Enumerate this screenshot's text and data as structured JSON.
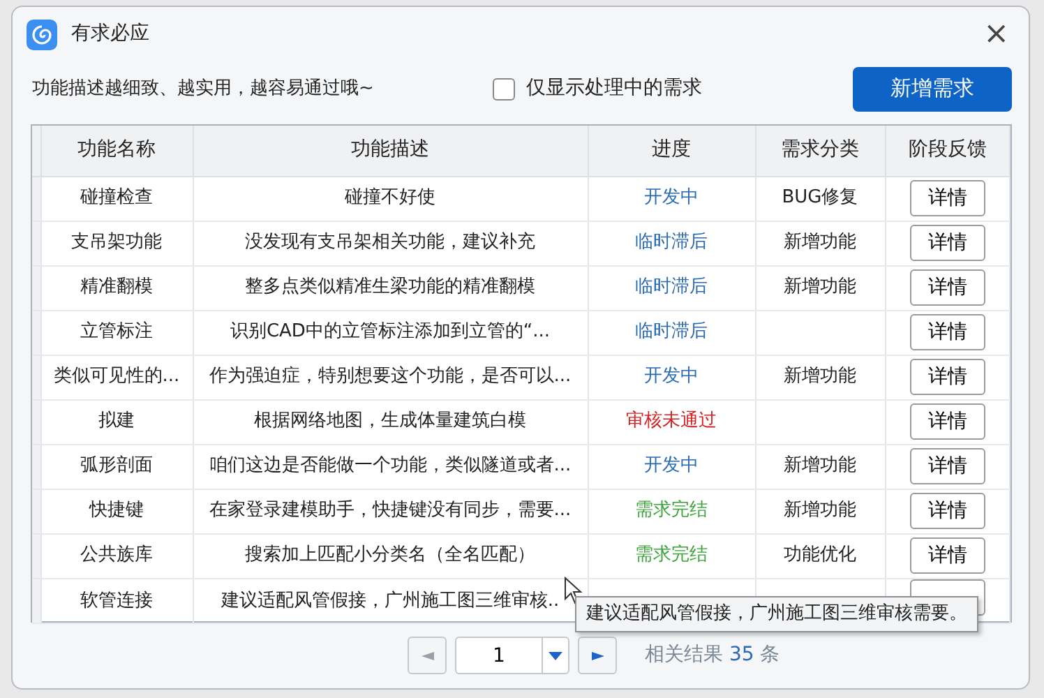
{
  "window": {
    "title": "有求必应",
    "close": "×"
  },
  "toolbar": {
    "hint": "功能描述越细致、越实用，越容易通过哦~",
    "filter": {
      "label": "仅显示处理中的需求",
      "checked": false
    },
    "add_button": "新增需求"
  },
  "table": {
    "columns": [
      "功能名称",
      "功能描述",
      "进度",
      "需求分类",
      "阶段反馈"
    ],
    "rows": [
      {
        "name": "碰撞检查",
        "description": "碰撞不好使",
        "progress": "开发中",
        "color": "#2a6ab5",
        "category": "BUG修复",
        "action": "详情"
      },
      {
        "name": "支吊架功能",
        "description": "没发现有支吊架相关功能，建议补充",
        "progress": "临时滞后",
        "color": "#2a6ab5",
        "category": "新增功能",
        "action": "详情"
      },
      {
        "name": "精准翻模",
        "description": "整多点类似精准生梁功能的精准翻模",
        "progress": "临时滞后",
        "color": "#2a6ab5",
        "category": "新增功能",
        "action": "详情"
      },
      {
        "name": "立管标注",
        "description": "识别CAD中的立管标注添加到立管的“...",
        "progress": "临时滞后",
        "color": "#2a6ab5",
        "category": "",
        "action": "详情"
      },
      {
        "name": "类似可见性的...",
        "description": "作为强迫症，特别想要这个功能，是否可以...",
        "progress": "开发中",
        "color": "#2a6ab5",
        "category": "新增功能",
        "action": "详情"
      },
      {
        "name": "拟建",
        "description": "根据网络地图，生成体量建筑白模",
        "progress": "审核未通过",
        "color": "#d42020",
        "category": "",
        "action": "详情"
      },
      {
        "name": "弧形剖面",
        "description": "咱们这边是否能做一个功能，类似隧道或者...",
        "progress": "开发中",
        "color": "#2a6ab5",
        "category": "新增功能",
        "action": "详情"
      },
      {
        "name": "快捷键",
        "description": "在家登录建模助手，快捷键没有同步，需要...",
        "progress": "需求完结",
        "color": "#3aa53a",
        "category": "新增功能",
        "action": "详情"
      },
      {
        "name": "公共族库",
        "description": "搜索加上匹配小分类名（全名匹配）",
        "progress": "需求完结",
        "color": "#3aa53a",
        "category": "功能优化",
        "action": "详情"
      },
      {
        "name": "软管连接",
        "description": "建议适配风管假接，广州施工图三维审核.."
      }
    ]
  },
  "tooltip": "建议适配风管假接，广州施工图三维审核需要。",
  "pagination": {
    "page": "1",
    "result_prefix": "相关结果",
    "result_count": "35",
    "result_suffix": "条"
  }
}
